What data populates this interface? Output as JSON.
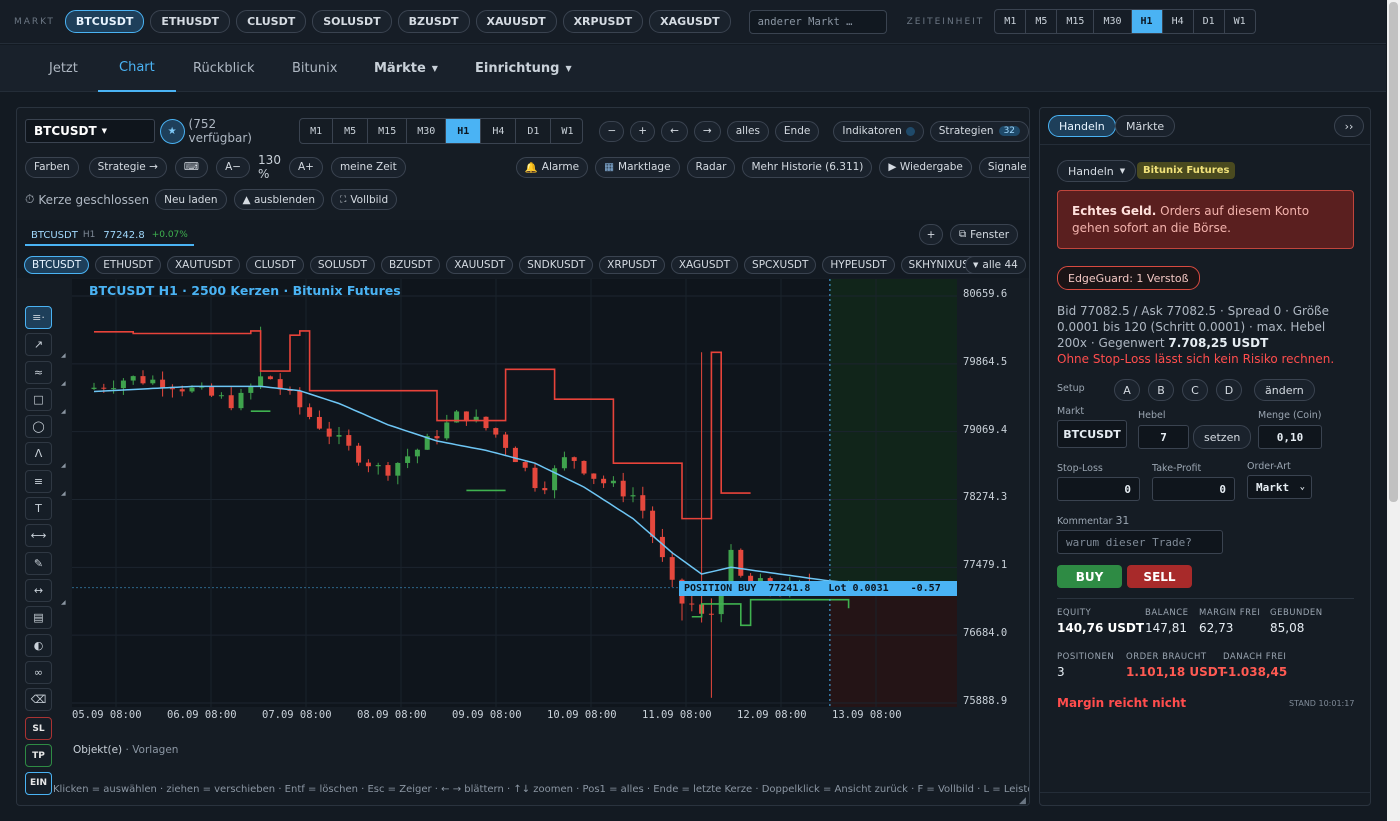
{
  "topbar": {
    "markt_label": "MARKT",
    "markets": [
      "BTCUSDT",
      "ETHUSDT",
      "CLUSDT",
      "SOLUSDT",
      "BZUSDT",
      "XAUUSDT",
      "XRPUSDT",
      "XAGUSDT"
    ],
    "search_placeholder": "anderer Markt …",
    "zeit_label": "ZEITEINHEIT",
    "timeframes": [
      "M1",
      "M5",
      "M15",
      "M30",
      "H1",
      "H4",
      "D1",
      "W1"
    ]
  },
  "nav": {
    "tabs": [
      "Jetzt",
      "Chart",
      "Rückblick",
      "Bitunix",
      "Märkte",
      "Einrichtung"
    ]
  },
  "chart": {
    "symbol": "BTCUSDT",
    "available": "(752 verfügbar)",
    "timeframes": [
      "M1",
      "M5",
      "M15",
      "M30",
      "H1",
      "H4",
      "D1",
      "W1"
    ],
    "nav_buttons": [
      "−",
      "+",
      "←",
      "→",
      "alles",
      "Ende"
    ],
    "indikatoren": "Indikatoren",
    "strategien": "Strategien",
    "strategien_count": "32",
    "row2": {
      "farben": "Farben",
      "strategie": "Strategie →",
      "a_minus": "A−",
      "zoom": "130 %",
      "a_plus": "A+",
      "meine_zeit": "meine Zeit",
      "alarme": "Alarme",
      "marktlage": "Marktlage",
      "radar": "Radar",
      "historie": "Mehr Historie (6.311)",
      "wiedergabe": "▶ Wiedergabe",
      "signale": "Signale der Historie"
    },
    "row3": {
      "kerze": "Kerze geschlossen",
      "neu_laden": "Neu laden",
      "ausblenden": "▲ ausblenden",
      "vollbild": "Vollbild"
    },
    "ticker": {
      "sym": "BTCUSDT",
      "tf": "H1",
      "price": "77242.8",
      "chg": "+0.07%"
    },
    "plus": "+",
    "fenster": "Fenster",
    "symbols": [
      "BTCUSDT",
      "ETHUSDT",
      "XAUTUSDT",
      "CLUSDT",
      "SOLUSDT",
      "BZUSDT",
      "XAUUSDT",
      "SNDKUSDT",
      "XRPUSDT",
      "XAGUSDT",
      "SPCXUSDT",
      "HYPEUSDT",
      "SKHYNIXUSDT"
    ],
    "alle": "alle 44",
    "title": "BTCUSDT H1 · 2500 Kerzen · Bitunix Futures",
    "y_ticks": [
      "80659.6",
      "79864.5",
      "79069.4",
      "78274.3",
      "77479.1",
      "76684.0",
      "75888.9"
    ],
    "x_ticks": [
      "05.09 08:00",
      "06.09 08:00",
      "07.09 08:00",
      "08.09 08:00",
      "09.09 08:00",
      "10.09 08:00",
      "11.09 08:00",
      "12.09 08:00",
      "13.09 08:00"
    ],
    "position": {
      "label": "POSITION BUY",
      "price": "77241.8",
      "lot": "Lot 0.0031",
      "pnl": "-0.57"
    },
    "tools_bottom": [
      "SL",
      "TP",
      "EIN"
    ],
    "objekte": "Objekt(e)",
    "vorlagen": "· Vorlagen",
    "help": "Klicken = auswählen · ziehen = verschieben · Entf = löschen · Esc = Zeiger · ← → blättern · ↑↓ zoomen · Pos1 = alles · Ende = letzte Kerze · Doppelklick = Ansicht zurück · F = Vollbild · L = Leisten aus",
    "colors": {
      "up": "#3fa34d",
      "down": "#e5483d",
      "ma": "#6ec6f5",
      "stop_red": "#e8433a",
      "stop_green": "#3fb24f"
    }
  },
  "chart_data": {
    "type": "candlestick",
    "ylim": [
      75888.9,
      80659.6
    ],
    "x_ticks": [
      "05.09 08:00",
      "06.09 08:00",
      "07.09 08:00",
      "08.09 08:00",
      "09.09 08:00",
      "10.09 08:00",
      "11.09 08:00",
      "12.09 08:00",
      "13.09 08:00"
    ],
    "position_price": 77241.8,
    "close_keypoints": [
      [
        0,
        79570
      ],
      [
        4,
        79700
      ],
      [
        8,
        79650
      ],
      [
        12,
        79500
      ],
      [
        15,
        79400
      ],
      [
        18,
        79750
      ],
      [
        22,
        79300
      ],
      [
        26,
        78900
      ],
      [
        30,
        78600
      ],
      [
        34,
        78900
      ],
      [
        38,
        79300
      ],
      [
        42,
        79000
      ],
      [
        46,
        78400
      ],
      [
        49,
        78800
      ],
      [
        52,
        78500
      ],
      [
        56,
        78300
      ],
      [
        58,
        77700
      ],
      [
        60,
        77100
      ],
      [
        62,
        77000
      ],
      [
        63,
        76700
      ],
      [
        64,
        77200
      ],
      [
        65,
        77500
      ],
      [
        66,
        77700
      ],
      [
        67,
        77000
      ],
      [
        68,
        77300
      ],
      [
        70,
        77200
      ],
      [
        72,
        77250
      ],
      [
        74,
        77280
      ],
      [
        77,
        77240
      ]
    ],
    "ma_keypoints": [
      [
        0,
        79540
      ],
      [
        10,
        79600
      ],
      [
        17,
        79600
      ],
      [
        21,
        79550
      ],
      [
        25,
        79400
      ],
      [
        30,
        79150
      ],
      [
        35,
        78960
      ],
      [
        40,
        78850
      ],
      [
        45,
        78700
      ],
      [
        50,
        78420
      ],
      [
        55,
        78050
      ],
      [
        59,
        77650
      ],
      [
        62,
        77400
      ],
      [
        65,
        77480
      ],
      [
        70,
        77400
      ],
      [
        75,
        77320
      ],
      [
        77,
        77300
      ]
    ],
    "stop_red": [
      [
        0,
        80240
      ],
      [
        4,
        80220
      ],
      [
        16,
        80250
      ],
      [
        17,
        79780
      ],
      [
        19,
        79780
      ],
      [
        20,
        80200
      ],
      [
        21,
        80250
      ],
      [
        22,
        79550
      ],
      [
        34,
        79550
      ],
      [
        35,
        79200
      ],
      [
        41,
        79200
      ],
      [
        42,
        79800
      ],
      [
        46,
        79800
      ],
      [
        47,
        79450
      ],
      [
        52,
        79450
      ],
      [
        53,
        78700
      ],
      [
        59,
        78700
      ],
      [
        60,
        78050
      ],
      [
        62,
        78050
      ],
      [
        63,
        80000
      ],
      [
        64,
        78350
      ],
      [
        67,
        78350
      ]
    ],
    "stop_green": [
      [
        16,
        79310
      ],
      [
        18,
        79310
      ],
      [
        38,
        78380
      ],
      [
        42,
        78380
      ],
      [
        61,
        76900
      ],
      [
        62,
        77050
      ],
      [
        64,
        77050
      ],
      [
        66,
        76800
      ],
      [
        67,
        77100
      ],
      [
        77,
        77000
      ]
    ]
  },
  "right": {
    "tabs": [
      "Handeln",
      "Märkte"
    ],
    "collapse": "››",
    "handeln_btn": "Handeln",
    "badge": "Bitunix Futures",
    "warn_bold": "Echtes Geld.",
    "warn_text": "Orders auf diesem Konto gehen sofort an die Börse.",
    "edgeguard": "EdgeGuard: 1 Verstoß",
    "info": "Bid 77082.5 / Ask 77082.5 · Spread 0 · Größe 0.0001 bis 120 (Schritt 0.0001) · max. Hebel 200x · Gegenwert",
    "info_value": "7.708,25 USDT",
    "warn_sl": "Ohne Stop-Loss lässt sich kein Risiko rechnen.",
    "setup_label": "Setup",
    "setups": [
      "A",
      "B",
      "C",
      "D"
    ],
    "aendern": "ändern",
    "markt_label": "Markt",
    "markt_value": "BTCUSDT",
    "hebel_label": "Hebel",
    "hebel_value": "7",
    "setzen": "setzen",
    "menge_label": "Menge (Coin)",
    "menge_value": "0,10",
    "sl_label": "Stop-Loss",
    "sl_value": "0",
    "tp_label": "Take-Profit",
    "tp_value": "0",
    "art_label": "Order-Art",
    "art_value": "Markt",
    "kommentar_label": "Kommentar",
    "kommentar_count": "31",
    "kommentar_placeholder": "warum dieser Trade?",
    "buy": "BUY",
    "sell": "SELL",
    "equity_label": "EQUITY",
    "equity": "140,76 USDT",
    "balance_label": "BALANCE",
    "balance": "147,81",
    "marginfrei_label": "MARGIN FREI",
    "marginfrei": "62,73",
    "gebunden_label": "GEBUNDEN",
    "gebunden": "85,08",
    "positionen_label": "POSITIONEN",
    "positionen": "3",
    "order_label": "ORDER BRAUCHT",
    "order": "1.101,18 USDT",
    "danach_label": "DANACH FREI",
    "danach": "-1.038,45",
    "margin_warn": "Margin reicht nicht",
    "stand": "STAND 10:01:17"
  }
}
